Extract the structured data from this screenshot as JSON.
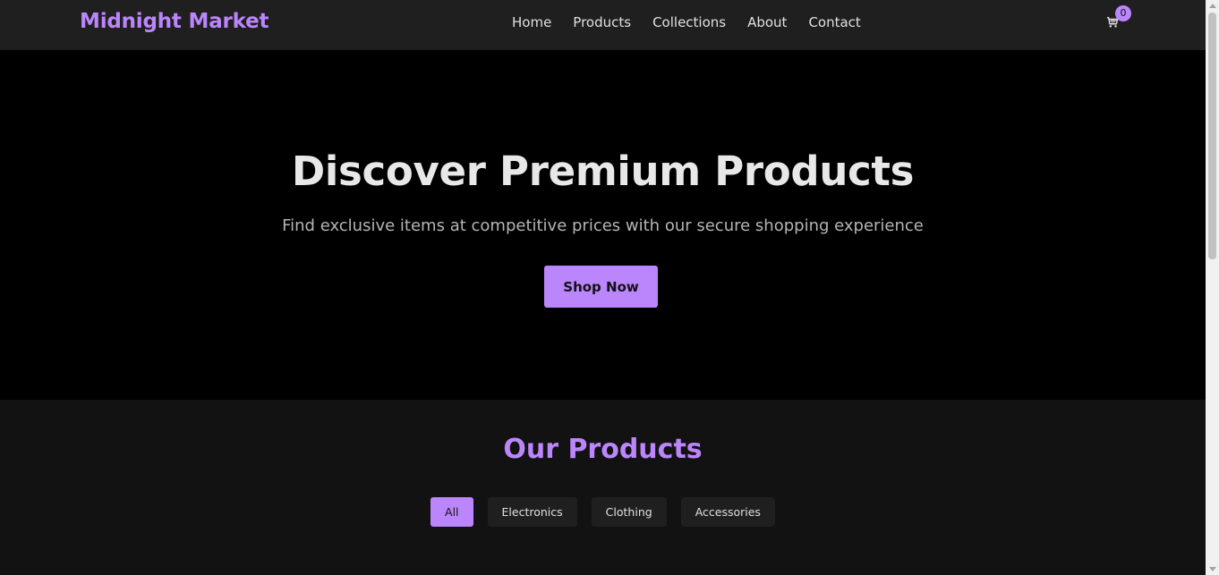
{
  "header": {
    "logo": "Midnight Market",
    "nav": [
      "Home",
      "Products",
      "Collections",
      "About",
      "Contact"
    ],
    "cart_icon": "shopping-cart-icon",
    "cart_count": "0"
  },
  "hero": {
    "title": "Discover Premium Products",
    "subtitle": "Find exclusive items at competitive prices with our secure shopping experience",
    "cta": "Shop Now"
  },
  "products": {
    "title": "Our Products",
    "filters": [
      "All",
      "Electronics",
      "Clothing",
      "Accessories"
    ],
    "active_filter": "All"
  },
  "colors": {
    "accent": "#bb86fc",
    "background": "#121212",
    "header_bg": "#1f1f1f",
    "hero_bg": "#000000"
  }
}
